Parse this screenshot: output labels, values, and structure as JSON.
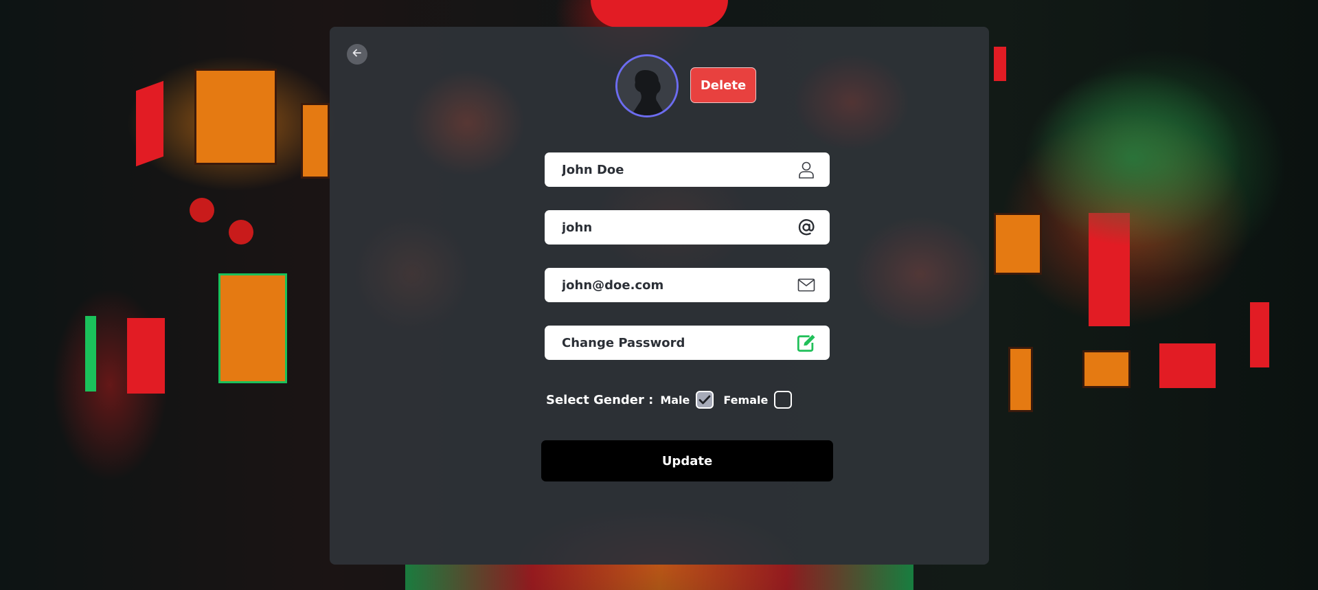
{
  "profile": {
    "delete_label": "Delete",
    "back_icon": "arrow-left-icon",
    "avatar_icon": "avatar-silhouette"
  },
  "fields": {
    "name": {
      "value": "John Doe",
      "icon": "user-icon"
    },
    "username": {
      "value": "john",
      "icon": "at-icon"
    },
    "email": {
      "value": "john@doe.com",
      "icon": "mail-icon"
    },
    "password": {
      "value": "Change Password",
      "icon": "edit-icon"
    }
  },
  "gender": {
    "title": "Select Gender :",
    "options": [
      {
        "label": "Male",
        "checked": true
      },
      {
        "label": "Female",
        "checked": false
      }
    ]
  },
  "update_label": "Update",
  "colors": {
    "delete": "#e8413f",
    "avatar_ring": "#6c6cf0",
    "edit_icon": "#21c05a",
    "update_bg": "#000000"
  }
}
